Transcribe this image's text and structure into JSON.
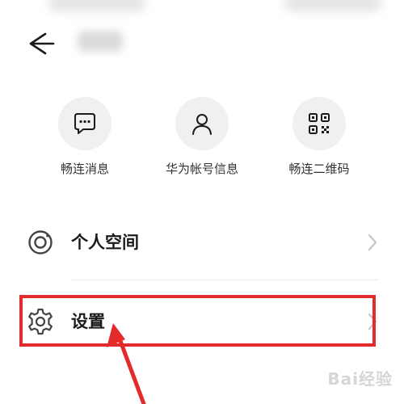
{
  "quick_actions": [
    {
      "label": "畅连消息",
      "icon": "chat-bubble-icon"
    },
    {
      "label": "华为帐号信息",
      "icon": "user-icon"
    },
    {
      "label": "畅连二维码",
      "icon": "qr-code-icon"
    }
  ],
  "menu": {
    "personal_space": "个人空间",
    "settings": "设置"
  },
  "watermark_text": "Bai经验",
  "colors": {
    "highlight": "#e32b2b",
    "icon_circle_bg": "#f0f0f0"
  }
}
